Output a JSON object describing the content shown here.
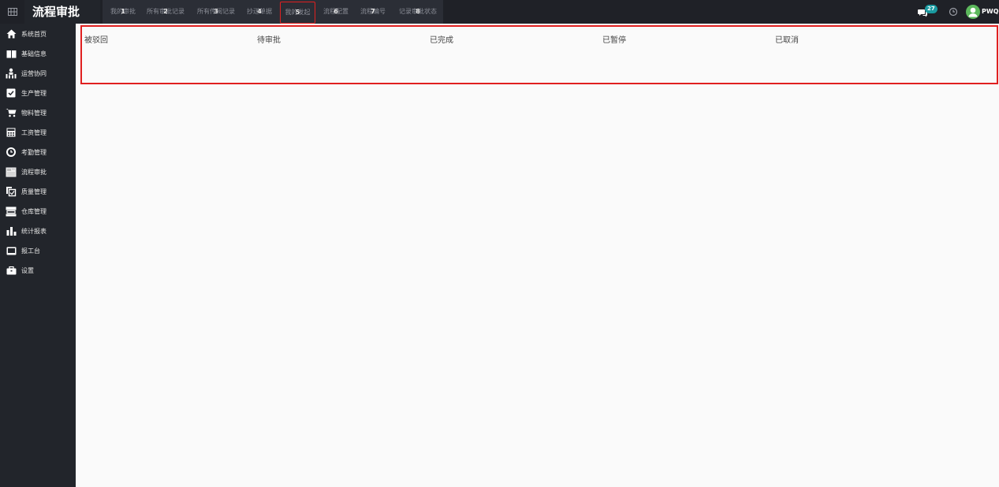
{
  "app": {
    "title": "流程审批"
  },
  "tabs": [
    {
      "label": "我的审批",
      "num": "1"
    },
    {
      "label": "所有审批记录",
      "num": "2"
    },
    {
      "label": "所有传阅记录",
      "num": "3"
    },
    {
      "label": "抄送单据",
      "num": "4"
    },
    {
      "label": "我的发起",
      "num": "5"
    },
    {
      "label": "流程配置",
      "num": "6"
    },
    {
      "label": "流程编号",
      "num": "7"
    },
    {
      "label": "记录审批状态",
      "num": "8"
    }
  ],
  "topright": {
    "message_count": "27",
    "username": "PWQ"
  },
  "sidebar": {
    "items": [
      {
        "label": "系统首页",
        "icon": "home-icon"
      },
      {
        "label": "基础信息",
        "icon": "book-icon"
      },
      {
        "label": "运营协同",
        "icon": "team-icon"
      },
      {
        "label": "生产管理",
        "icon": "checkbox-icon"
      },
      {
        "label": "物料管理",
        "icon": "cart-icon"
      },
      {
        "label": "工资管理",
        "icon": "calculator-icon"
      },
      {
        "label": "考勤管理",
        "icon": "clock-history-icon"
      },
      {
        "label": "流程审批",
        "icon": "approval-icon"
      },
      {
        "label": "质量管理",
        "icon": "quality-icon"
      },
      {
        "label": "仓库管理",
        "icon": "warehouse-icon"
      },
      {
        "label": "统计报表",
        "icon": "bar-chart-icon"
      },
      {
        "label": "报工台",
        "icon": "monitor-icon"
      },
      {
        "label": "设置",
        "icon": "briefcase-icon"
      }
    ]
  },
  "status_filters": [
    "被驳回",
    "待审批",
    "已完成",
    "已暂停",
    "已取消"
  ],
  "colors": {
    "topbar_bg": "#1f2127",
    "sidebar_bg": "#22252b",
    "tabs_bg": "#2b2e36",
    "highlight": "#e02020",
    "badge": "#1a9aa0",
    "avatar": "#5cb85c",
    "content_bg": "#fafafa"
  }
}
